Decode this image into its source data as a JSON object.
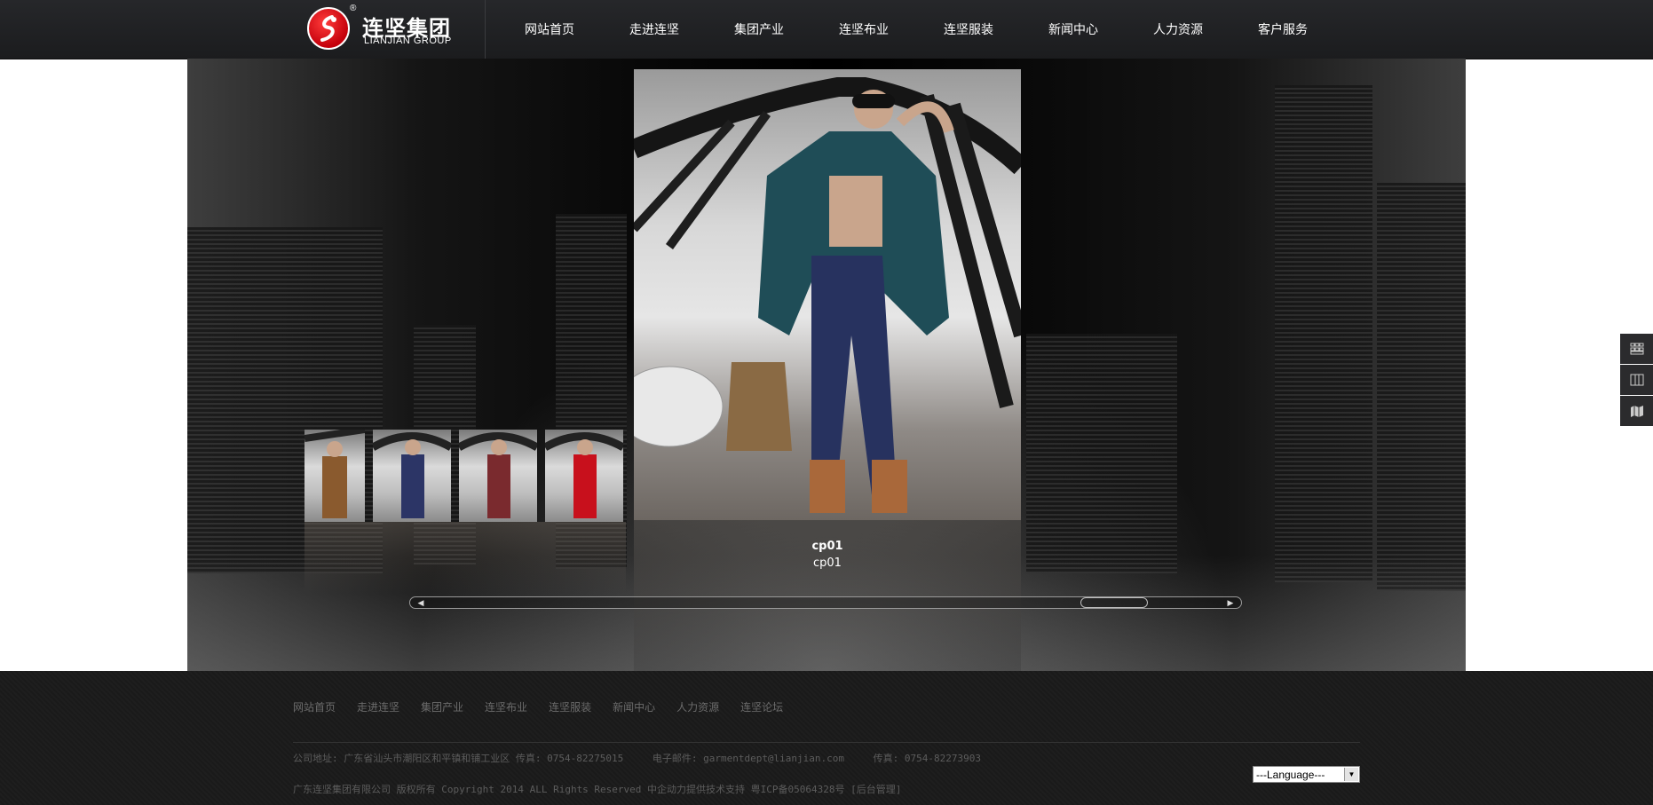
{
  "header": {
    "logo_name": "连坚集团",
    "logo_english": "LIANJIAN GROUP",
    "logo_reg": "®",
    "nav": [
      {
        "label": "网站首页"
      },
      {
        "label": "走进连坚"
      },
      {
        "label": "集团产业"
      },
      {
        "label": "连坚布业"
      },
      {
        "label": "连坚服装"
      },
      {
        "label": "新闻中心"
      },
      {
        "label": "人力资源"
      },
      {
        "label": "客户服务"
      }
    ]
  },
  "gallery": {
    "caption_title": "cp01",
    "caption_sub": "cp01",
    "thumbnail_count": 4,
    "scroll_left_icon": "triangle-left-icon",
    "scroll_right_icon": "triangle-right-icon",
    "scroll_position": 0.9
  },
  "side_tools": [
    {
      "icon": "grid-icon"
    },
    {
      "icon": "columns-icon"
    },
    {
      "icon": "map-icon"
    }
  ],
  "footer": {
    "nav": [
      {
        "label": "网站首页"
      },
      {
        "label": "走进连坚"
      },
      {
        "label": "集团产业"
      },
      {
        "label": "连坚布业"
      },
      {
        "label": "连坚服装"
      },
      {
        "label": "新闻中心"
      },
      {
        "label": "人力资源"
      },
      {
        "label": "连坚论坛"
      }
    ],
    "address": "公司地址: 广东省汕头市潮阳区和平镇和铺工业区 传真: 0754-82275015",
    "email": "电子邮件: garmentdept@lianjian.com",
    "fax": "传真: 0754-82273903",
    "copyright": "广东连坚集团有限公司 版权所有 Copyright 2014 ALL Rights Reserved 中企动力提供技术支持 粤ICP备05064328号 [后台管理]",
    "language_select": "---Language---"
  }
}
